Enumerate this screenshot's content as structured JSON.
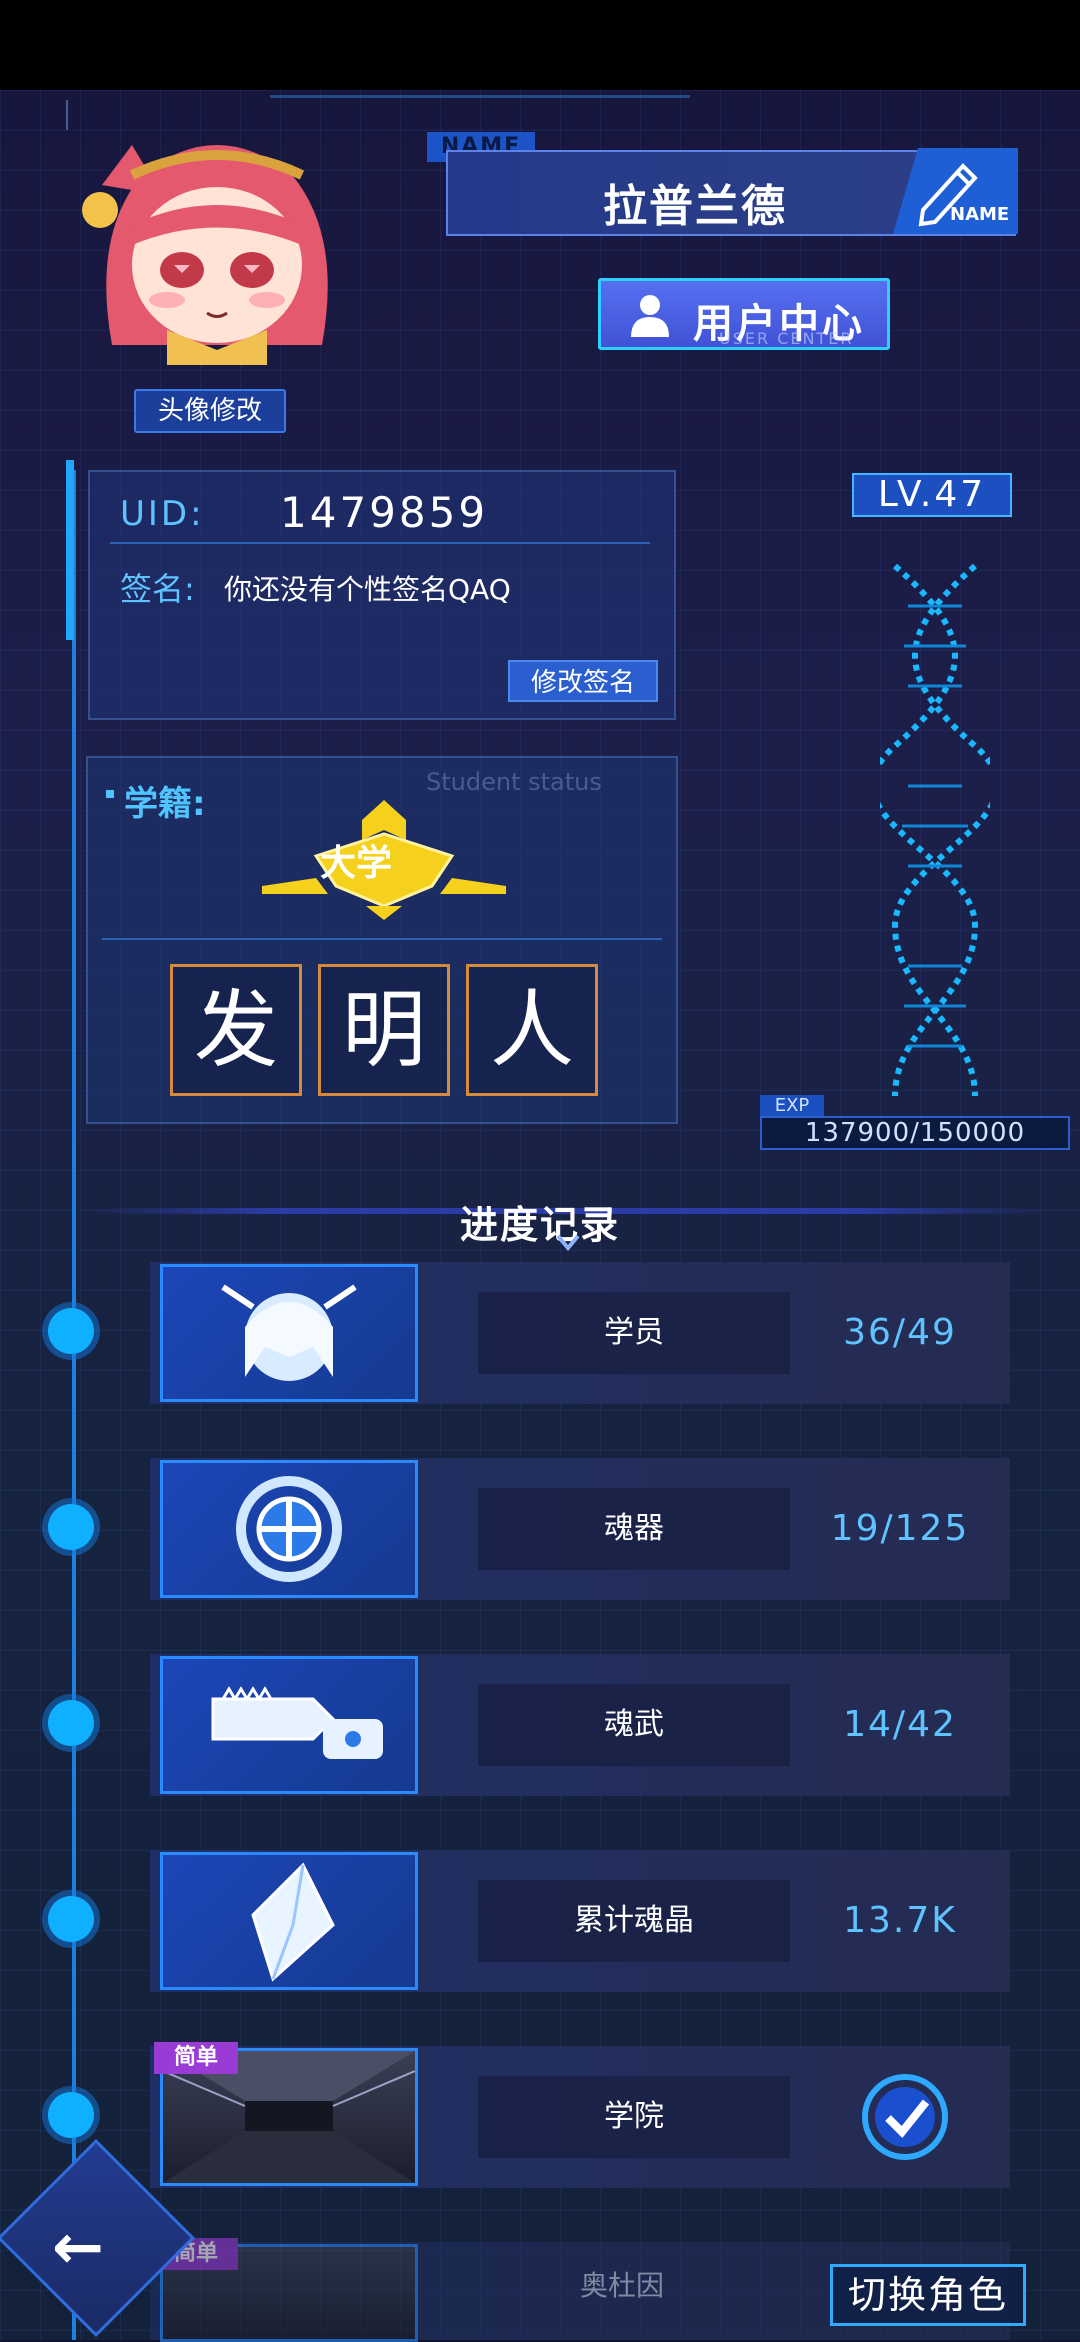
{
  "profile": {
    "avatar_edit_label": "头像修改",
    "name_tag": "NAME",
    "name": "拉普兰德",
    "name_edit_label": "NAME",
    "user_center_label": "用户中心",
    "user_center_sub": "USER CENTER"
  },
  "info": {
    "uid_label": "UID:",
    "uid_value": "1479859",
    "signature_label": "签名:",
    "signature_value": "你还没有个性签名QAQ",
    "signature_edit_label": "修改签名"
  },
  "student_status": {
    "label": "学籍:",
    "label_en": "Student status",
    "badge_text": "大学",
    "title_chars": [
      "发",
      "明",
      "人"
    ]
  },
  "level": {
    "label": "LV.47",
    "exp_label": "EXP",
    "exp_value": "137900/150000",
    "exp_fraction": 0.919
  },
  "progress": {
    "title": "进度记录",
    "rows": [
      {
        "name": "学员",
        "value": "36/49"
      },
      {
        "name": "魂器",
        "value": "19/125"
      },
      {
        "name": "魂武",
        "value": "14/42"
      },
      {
        "name": "累计魂晶",
        "value": "13.7K"
      },
      {
        "name": "学院",
        "badge": "简单",
        "completed": true
      },
      {
        "name": "奥杜因",
        "badge": "简单"
      }
    ]
  },
  "bottom": {
    "switch_label": "切换角色"
  },
  "colors": {
    "accent": "#5fc3ff",
    "panel_border": "#35518f",
    "badge_purple": "#9a3bd6",
    "title_border": "#d68a3c"
  }
}
